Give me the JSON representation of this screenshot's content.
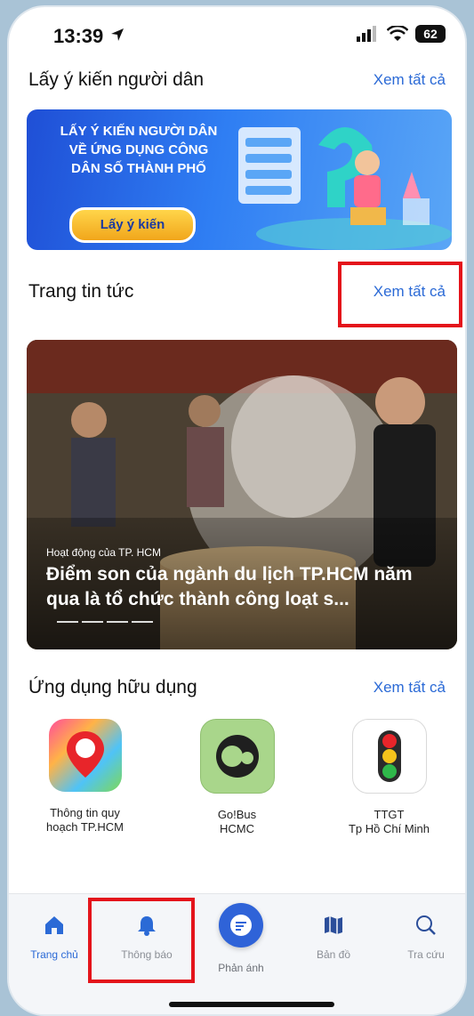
{
  "status_bar": {
    "time": "13:39",
    "battery": "62"
  },
  "survey_section": {
    "title": "Lấy ý kiến người dân",
    "see_all": "Xem tất cả",
    "banner": {
      "line1": "LẤY Ý KIẾN NGƯỜI DÂN",
      "line2": "VỀ ỨNG DỤNG CÔNG",
      "line3": "DÂN SỐ THÀNH PHỐ",
      "button": "Lấy ý kiến"
    }
  },
  "news_section": {
    "title": "Trang tin tức",
    "see_all": "Xem tất cả",
    "card": {
      "category": "Hoạt động của TP. HCM",
      "headline": "Điểm son của ngành du lịch TP.HCM năm qua là tổ chức thành công loạt s..."
    }
  },
  "apps_section": {
    "title": "Ứng dụng hữu dụng",
    "see_all": "Xem tất cả",
    "apps": [
      {
        "line1": "Thông tin quy",
        "line2": "hoạch TP.HCM",
        "icon": "map-pin-icon"
      },
      {
        "line1": "Go!Bus",
        "line2": "HCMC",
        "icon": "gobus-icon"
      },
      {
        "line1": "TTGT",
        "line2": "Tp Hồ Chí Minh",
        "icon": "traffic-light-icon"
      }
    ]
  },
  "tabbar": {
    "tabs": [
      {
        "label": "Trang chủ",
        "icon": "home-icon",
        "active": true
      },
      {
        "label": "Thông báo",
        "icon": "bell-icon"
      },
      {
        "label": "Phản ánh",
        "icon": "chat-icon"
      },
      {
        "label": "Bản đồ",
        "icon": "map-icon"
      },
      {
        "label": "Tra cứu",
        "icon": "search-icon"
      }
    ]
  },
  "colors": {
    "accent": "#2b6ad6",
    "highlight": "#e4141b"
  }
}
